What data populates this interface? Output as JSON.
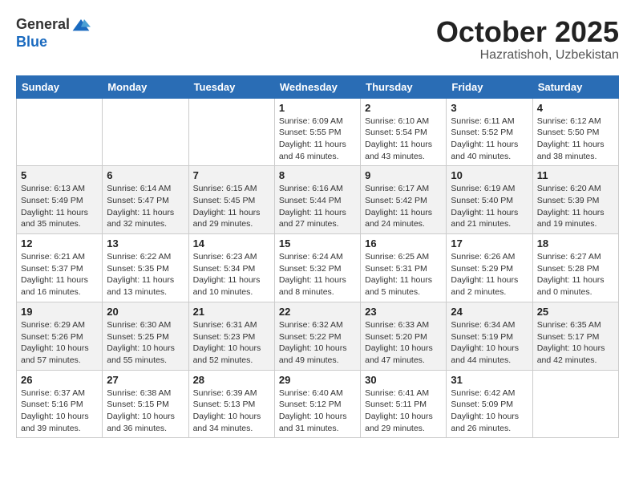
{
  "logo": {
    "general": "General",
    "blue": "Blue"
  },
  "header": {
    "month": "October 2025",
    "location": "Hazratishoh, Uzbekistan"
  },
  "weekdays": [
    "Sunday",
    "Monday",
    "Tuesday",
    "Wednesday",
    "Thursday",
    "Friday",
    "Saturday"
  ],
  "weeks": [
    [
      {
        "day": "",
        "sunrise": "",
        "sunset": "",
        "daylight": ""
      },
      {
        "day": "",
        "sunrise": "",
        "sunset": "",
        "daylight": ""
      },
      {
        "day": "",
        "sunrise": "",
        "sunset": "",
        "daylight": ""
      },
      {
        "day": "1",
        "sunrise": "Sunrise: 6:09 AM",
        "sunset": "Sunset: 5:55 PM",
        "daylight": "Daylight: 11 hours and 46 minutes."
      },
      {
        "day": "2",
        "sunrise": "Sunrise: 6:10 AM",
        "sunset": "Sunset: 5:54 PM",
        "daylight": "Daylight: 11 hours and 43 minutes."
      },
      {
        "day": "3",
        "sunrise": "Sunrise: 6:11 AM",
        "sunset": "Sunset: 5:52 PM",
        "daylight": "Daylight: 11 hours and 40 minutes."
      },
      {
        "day": "4",
        "sunrise": "Sunrise: 6:12 AM",
        "sunset": "Sunset: 5:50 PM",
        "daylight": "Daylight: 11 hours and 38 minutes."
      }
    ],
    [
      {
        "day": "5",
        "sunrise": "Sunrise: 6:13 AM",
        "sunset": "Sunset: 5:49 PM",
        "daylight": "Daylight: 11 hours and 35 minutes."
      },
      {
        "day": "6",
        "sunrise": "Sunrise: 6:14 AM",
        "sunset": "Sunset: 5:47 PM",
        "daylight": "Daylight: 11 hours and 32 minutes."
      },
      {
        "day": "7",
        "sunrise": "Sunrise: 6:15 AM",
        "sunset": "Sunset: 5:45 PM",
        "daylight": "Daylight: 11 hours and 29 minutes."
      },
      {
        "day": "8",
        "sunrise": "Sunrise: 6:16 AM",
        "sunset": "Sunset: 5:44 PM",
        "daylight": "Daylight: 11 hours and 27 minutes."
      },
      {
        "day": "9",
        "sunrise": "Sunrise: 6:17 AM",
        "sunset": "Sunset: 5:42 PM",
        "daylight": "Daylight: 11 hours and 24 minutes."
      },
      {
        "day": "10",
        "sunrise": "Sunrise: 6:19 AM",
        "sunset": "Sunset: 5:40 PM",
        "daylight": "Daylight: 11 hours and 21 minutes."
      },
      {
        "day": "11",
        "sunrise": "Sunrise: 6:20 AM",
        "sunset": "Sunset: 5:39 PM",
        "daylight": "Daylight: 11 hours and 19 minutes."
      }
    ],
    [
      {
        "day": "12",
        "sunrise": "Sunrise: 6:21 AM",
        "sunset": "Sunset: 5:37 PM",
        "daylight": "Daylight: 11 hours and 16 minutes."
      },
      {
        "day": "13",
        "sunrise": "Sunrise: 6:22 AM",
        "sunset": "Sunset: 5:35 PM",
        "daylight": "Daylight: 11 hours and 13 minutes."
      },
      {
        "day": "14",
        "sunrise": "Sunrise: 6:23 AM",
        "sunset": "Sunset: 5:34 PM",
        "daylight": "Daylight: 11 hours and 10 minutes."
      },
      {
        "day": "15",
        "sunrise": "Sunrise: 6:24 AM",
        "sunset": "Sunset: 5:32 PM",
        "daylight": "Daylight: 11 hours and 8 minutes."
      },
      {
        "day": "16",
        "sunrise": "Sunrise: 6:25 AM",
        "sunset": "Sunset: 5:31 PM",
        "daylight": "Daylight: 11 hours and 5 minutes."
      },
      {
        "day": "17",
        "sunrise": "Sunrise: 6:26 AM",
        "sunset": "Sunset: 5:29 PM",
        "daylight": "Daylight: 11 hours and 2 minutes."
      },
      {
        "day": "18",
        "sunrise": "Sunrise: 6:27 AM",
        "sunset": "Sunset: 5:28 PM",
        "daylight": "Daylight: 11 hours and 0 minutes."
      }
    ],
    [
      {
        "day": "19",
        "sunrise": "Sunrise: 6:29 AM",
        "sunset": "Sunset: 5:26 PM",
        "daylight": "Daylight: 10 hours and 57 minutes."
      },
      {
        "day": "20",
        "sunrise": "Sunrise: 6:30 AM",
        "sunset": "Sunset: 5:25 PM",
        "daylight": "Daylight: 10 hours and 55 minutes."
      },
      {
        "day": "21",
        "sunrise": "Sunrise: 6:31 AM",
        "sunset": "Sunset: 5:23 PM",
        "daylight": "Daylight: 10 hours and 52 minutes."
      },
      {
        "day": "22",
        "sunrise": "Sunrise: 6:32 AM",
        "sunset": "Sunset: 5:22 PM",
        "daylight": "Daylight: 10 hours and 49 minutes."
      },
      {
        "day": "23",
        "sunrise": "Sunrise: 6:33 AM",
        "sunset": "Sunset: 5:20 PM",
        "daylight": "Daylight: 10 hours and 47 minutes."
      },
      {
        "day": "24",
        "sunrise": "Sunrise: 6:34 AM",
        "sunset": "Sunset: 5:19 PM",
        "daylight": "Daylight: 10 hours and 44 minutes."
      },
      {
        "day": "25",
        "sunrise": "Sunrise: 6:35 AM",
        "sunset": "Sunset: 5:17 PM",
        "daylight": "Daylight: 10 hours and 42 minutes."
      }
    ],
    [
      {
        "day": "26",
        "sunrise": "Sunrise: 6:37 AM",
        "sunset": "Sunset: 5:16 PM",
        "daylight": "Daylight: 10 hours and 39 minutes."
      },
      {
        "day": "27",
        "sunrise": "Sunrise: 6:38 AM",
        "sunset": "Sunset: 5:15 PM",
        "daylight": "Daylight: 10 hours and 36 minutes."
      },
      {
        "day": "28",
        "sunrise": "Sunrise: 6:39 AM",
        "sunset": "Sunset: 5:13 PM",
        "daylight": "Daylight: 10 hours and 34 minutes."
      },
      {
        "day": "29",
        "sunrise": "Sunrise: 6:40 AM",
        "sunset": "Sunset: 5:12 PM",
        "daylight": "Daylight: 10 hours and 31 minutes."
      },
      {
        "day": "30",
        "sunrise": "Sunrise: 6:41 AM",
        "sunset": "Sunset: 5:11 PM",
        "daylight": "Daylight: 10 hours and 29 minutes."
      },
      {
        "day": "31",
        "sunrise": "Sunrise: 6:42 AM",
        "sunset": "Sunset: 5:09 PM",
        "daylight": "Daylight: 10 hours and 26 minutes."
      },
      {
        "day": "",
        "sunrise": "",
        "sunset": "",
        "daylight": ""
      }
    ]
  ]
}
